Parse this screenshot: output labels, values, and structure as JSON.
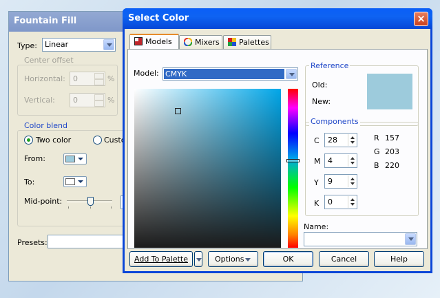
{
  "fountain_fill": {
    "title": "Fountain Fill",
    "type_label": "Type:",
    "type_value": "Linear",
    "center_offset": {
      "legend": "Center offset",
      "horizontal_label": "Horizontal:",
      "horizontal_value": "0",
      "vertical_label": "Vertical:",
      "vertical_value": "0",
      "unit": "%"
    },
    "color_blend": {
      "legend": "Color blend",
      "two_color_label": "Two color",
      "custom_label": "Custo",
      "from_label": "From:",
      "to_label": "To:",
      "midpoint_label": "Mid-point:",
      "from_color": "#9dcbdc",
      "to_color": "#ffffff"
    },
    "presets_label": "Presets:"
  },
  "select_color": {
    "title": "Select Color",
    "close_glyph": "×",
    "tabs": [
      {
        "label": "Models",
        "icon": "models-icon"
      },
      {
        "label": "Mixers",
        "icon": "mixers-icon"
      },
      {
        "label": "Palettes",
        "icon": "palettes-icon"
      }
    ],
    "model_label": "Model:",
    "model_value": "CMYK",
    "reference": {
      "legend": "Reference",
      "old_label": "Old:",
      "new_label": "New:",
      "old_color": "#9dcbdc",
      "new_color": "#9dcbdc"
    },
    "components": {
      "legend": "Components",
      "cmyk": [
        {
          "label": "C",
          "value": "28"
        },
        {
          "label": "M",
          "value": "4"
        },
        {
          "label": "Y",
          "value": "9"
        },
        {
          "label": "K",
          "value": "0"
        }
      ],
      "rgb": [
        {
          "label": "R",
          "value": "157"
        },
        {
          "label": "G",
          "value": "203"
        },
        {
          "label": "B",
          "value": "220"
        }
      ]
    },
    "name_label": "Name:",
    "name_value": "",
    "buttons": {
      "add_to_palette": "Add To Palette",
      "options": "Options",
      "ok": "OK",
      "cancel": "Cancel",
      "help": "Help"
    },
    "colors": {
      "hue": "#00a6e8",
      "title_bar": "#0a5ef7",
      "tab_highlight": "#e68b2c"
    }
  }
}
